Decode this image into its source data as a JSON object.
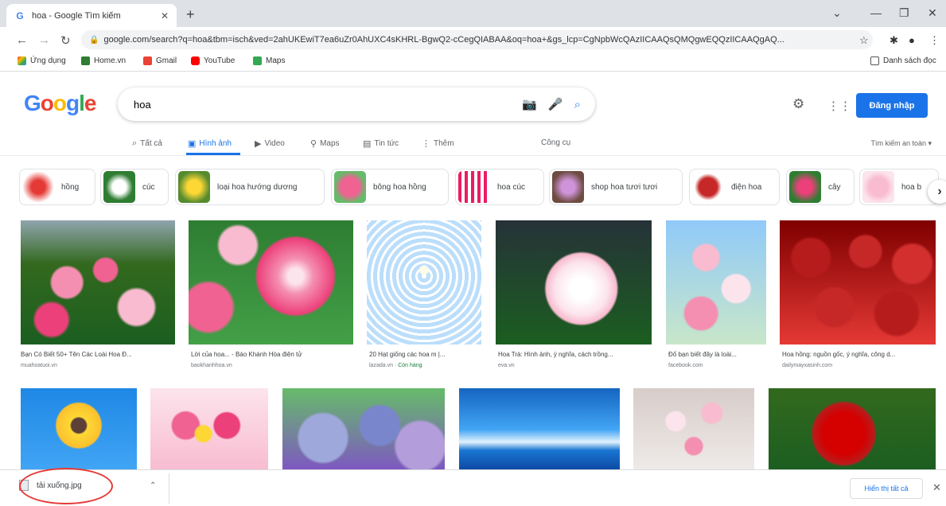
{
  "browser": {
    "tab_title": "hoa - Google Tìm kiếm",
    "tab_close": "✕",
    "new_tab": "+",
    "url": "google.com/search?q=hoa&tbm=isch&ved=2ahUKEwiT7ea6uZr0AhUXC4sKHRL-BgwQ2-cCegQIABAA&oq=hoa+&gs_lcp=CgNpbWcQAzIICAAQsQMQgwEQQzIICAAQgAQ...",
    "bookmarks": [
      "Ứng dụng",
      "Home.vn",
      "Gmail",
      "YouTube",
      "Maps"
    ],
    "reading_list": "Danh sách đọc"
  },
  "google": {
    "logo": "Google",
    "query": "hoa",
    "signin": "Đăng nhập",
    "tabs": [
      "Tất cả",
      "Hình ảnh",
      "Video",
      "Maps",
      "Tin tức",
      "Thêm"
    ],
    "tools": "Công cụ",
    "safesearch": "Tìm kiếm an toàn ▾"
  },
  "chips": [
    "hồng",
    "cúc",
    "loại hoa hướng dương",
    "bông hoa hồng",
    "hoa cúc",
    "shop hoa tươi tươi",
    "điện hoa",
    "cây",
    "hoa b"
  ],
  "results": [
    {
      "caption": "Bạn Có Biết 50+ Tên Các Loài Hoa Đ...",
      "source": "muahoatuoi.vn"
    },
    {
      "caption": "Lời của hoa... - Báo Khánh Hòa điện tử",
      "source": "baokhanhhoa.vn"
    },
    {
      "caption": "20 Hạt giống các hoa m |...",
      "source": "lazada.vn",
      "badge": "Còn hàng"
    },
    {
      "caption": "Hoa Trà: Hình ảnh, ý nghĩa, cách trồng...",
      "source": "eva.vn"
    },
    {
      "caption": "Đố bạn biết đây là loài...",
      "source": "facebook.com"
    },
    {
      "caption": "Hoa hồng: nguồn gốc, ý nghĩa, công d...",
      "source": "dailymayxasinh.com"
    }
  ],
  "download": {
    "filename": "tải xuống.jpg",
    "show_all": "Hiển thị tất cả",
    "close": "✕"
  }
}
